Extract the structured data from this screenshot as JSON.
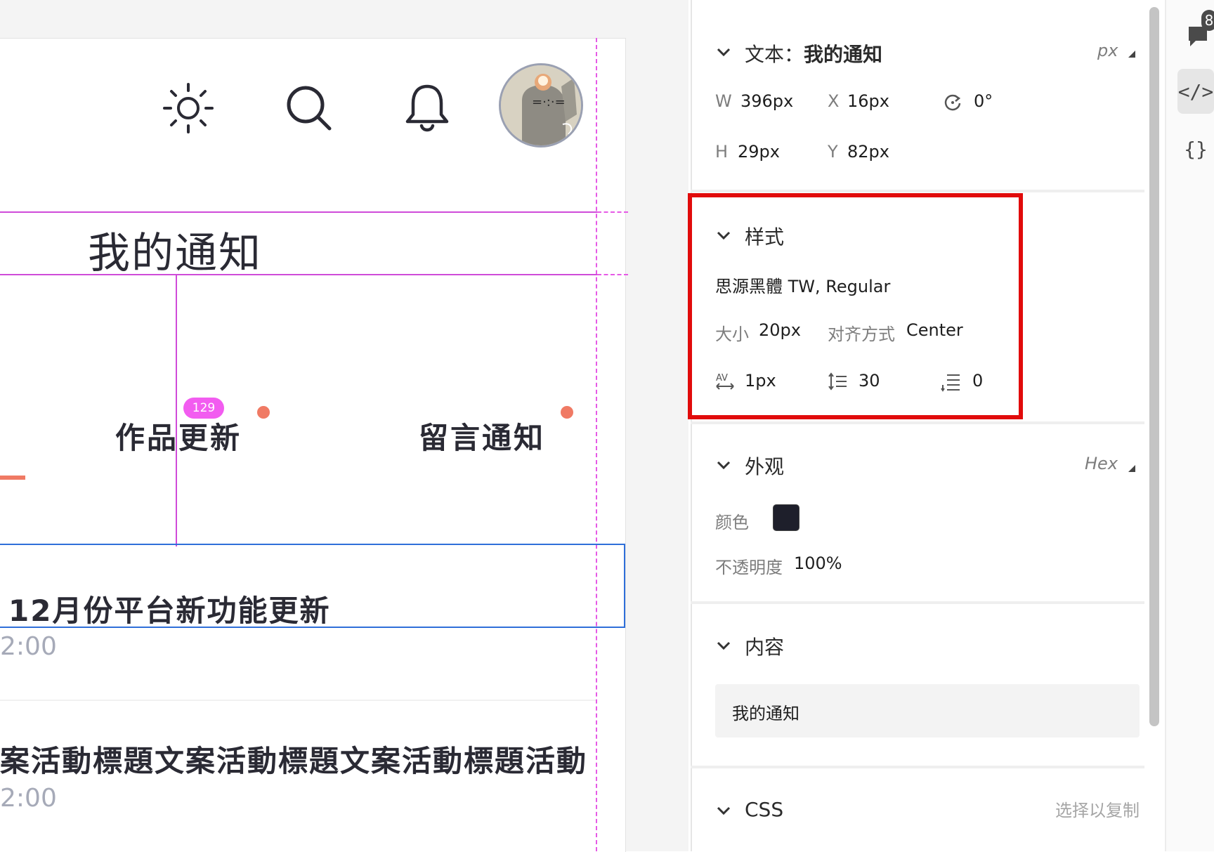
{
  "canvas": {
    "header_title": "我的通知",
    "tabs": [
      {
        "label": "作品更新",
        "badge": "129"
      },
      {
        "label": "留言通知"
      }
    ],
    "list": [
      {
        "title": "12月份平台新功能更新",
        "time": "2:00"
      },
      {
        "title": "案活動標題文案活動標題文案活動標題活動",
        "time": "2:00"
      }
    ]
  },
  "inspector": {
    "text_section": {
      "title_prefix": "文本：",
      "title_name": "我的通知",
      "unit": "px",
      "w_label": "W",
      "w_value": "396px",
      "x_label": "X",
      "x_value": "16px",
      "rotation_value": "0°",
      "h_label": "H",
      "h_value": "29px",
      "y_label": "Y",
      "y_value": "82px"
    },
    "style_section": {
      "title": "样式",
      "font": "思源黑體 TW, Regular",
      "size_label": "大小",
      "size_value": "20px",
      "align_label": "对齐方式",
      "align_value": "Center",
      "char_spacing_value": "1px",
      "line_height_value": "30",
      "para_spacing_value": "0"
    },
    "appearance_section": {
      "title": "外观",
      "format": "Hex",
      "color_label": "颜色",
      "color_value": "#1E1F2B",
      "opacity_label": "不透明度",
      "opacity_value": "100%"
    },
    "content_section": {
      "title": "内容",
      "value": "我的通知"
    },
    "css_section": {
      "title": "CSS",
      "hint": "选择以复制"
    }
  },
  "rail": {
    "comment_count": "8",
    "code_icon": "</>",
    "braces_icon": "{}"
  },
  "colors": {
    "guide": "#e65ae6",
    "selection": "#2f6fd9",
    "highlight": "#e10b0b",
    "accent_dot": "#f07a64",
    "badge": "#f25cf0"
  }
}
